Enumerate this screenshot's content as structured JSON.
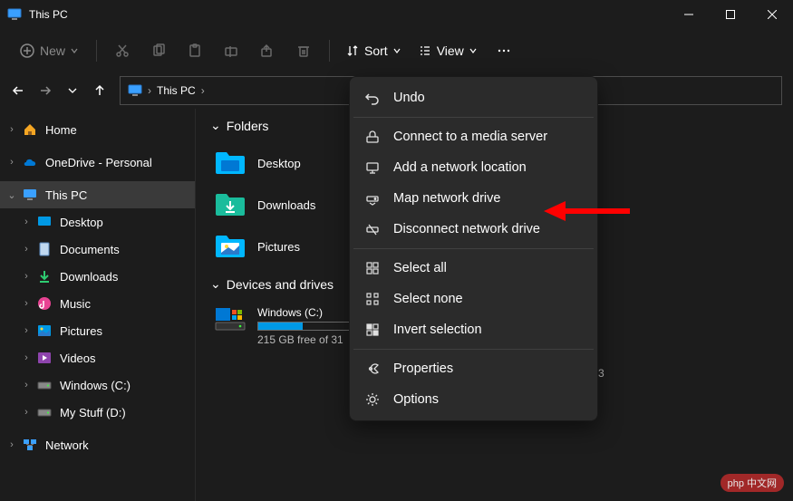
{
  "window": {
    "title": "This PC"
  },
  "toolbar": {
    "new_label": "New",
    "sort_label": "Sort",
    "view_label": "View"
  },
  "breadcrumb": {
    "location": "This PC"
  },
  "sidebar": {
    "home": "Home",
    "onedrive": "OneDrive - Personal",
    "thispc": "This PC",
    "desktop": "Desktop",
    "documents": "Documents",
    "downloads": "Downloads",
    "music": "Music",
    "pictures": "Pictures",
    "videos": "Videos",
    "windows_c": "Windows (C:)",
    "mystuff_d": "My Stuff (D:)",
    "network": "Network"
  },
  "content": {
    "folders_header": "Folders",
    "desktop": "Desktop",
    "downloads": "Downloads",
    "pictures": "Pictures",
    "drives_header": "Devices and drives",
    "drive_name": "Windows (C:)",
    "drive_free": "215 GB free of 31",
    "drive_extra": "3"
  },
  "menu": {
    "undo": "Undo",
    "connect_media": "Connect to a media server",
    "add_network_loc": "Add a network location",
    "map_drive": "Map network drive",
    "disconnect_drive": "Disconnect network drive",
    "select_all": "Select all",
    "select_none": "Select none",
    "invert_selection": "Invert selection",
    "properties": "Properties",
    "options": "Options"
  },
  "watermark": "php 中文网"
}
